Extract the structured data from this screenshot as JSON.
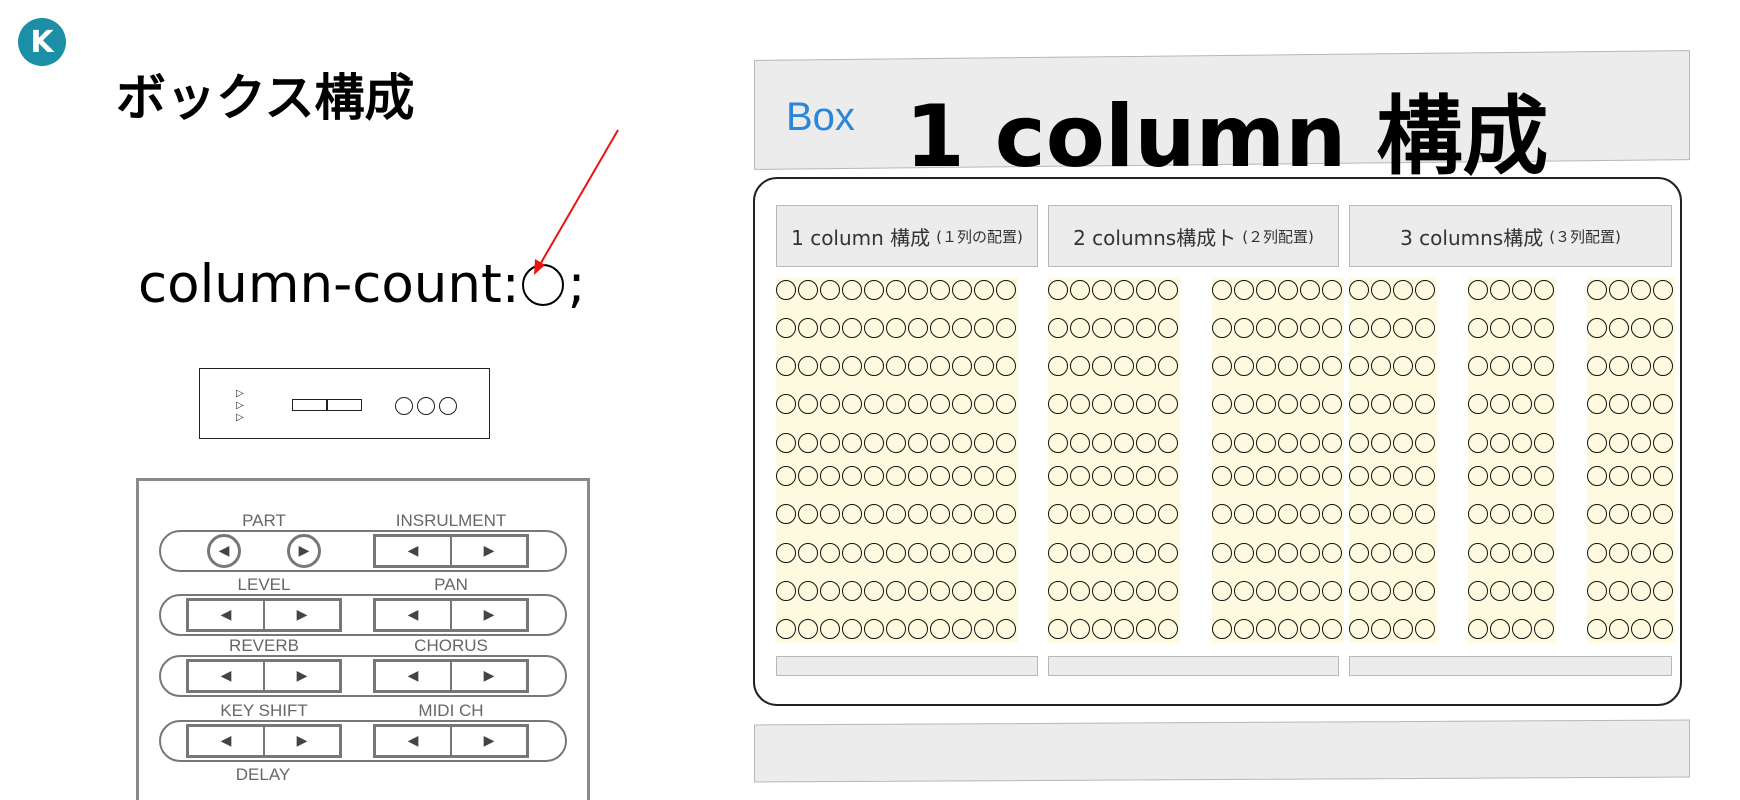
{
  "logo": {
    "letter": "K"
  },
  "side": {
    "title": "ボックス構成",
    "code_prefix": "column-count:",
    "code_suffix": ";"
  },
  "control_panel": {
    "labels": {
      "part": "PART",
      "instrument": "INSRULMENT",
      "level": "LEVEL",
      "pan": "PAN",
      "reverb": "REVERB",
      "chorus": "CHORUS",
      "key_shift": "KEY SHIFT",
      "midi_ch": "MIDI CH",
      "delay": "DELAY"
    },
    "left_glyph": "◀",
    "right_glyph": "▶"
  },
  "header": {
    "box_label": "Box",
    "title": "1 column 構成"
  },
  "columns": [
    {
      "title": "1 column 構成",
      "note": "(１列の配置)",
      "sub_columns": 1,
      "circles_per_row": 11
    },
    {
      "title": "2 columns構成ト",
      "note": "(２列配置)",
      "sub_columns": 2,
      "circles_per_row": 6
    },
    {
      "title": "3 columns構成",
      "note": "(３列配置)",
      "sub_columns": 3,
      "circles_per_row": 4
    }
  ],
  "rows": 10,
  "colors": {
    "accent_blue": "#2a86d8",
    "logo_teal": "#1a8fa6",
    "highlight_yellow": "#fdfadf",
    "bar_gray": "#ececec",
    "arrow_red": "#ee1111"
  }
}
